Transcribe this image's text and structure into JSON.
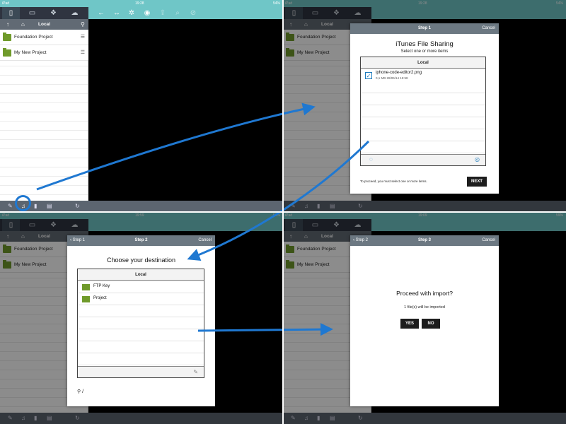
{
  "status_bar": {
    "device": "iPad",
    "time_q1": "19:28",
    "time_q2": "19:28",
    "time_q3": "19:59",
    "time_q4": "19:09",
    "battery_q1": "54%",
    "battery_q2": "54%",
    "battery_q3": "59%",
    "battery_q4": "59%"
  },
  "sidebar": {
    "title": "Local",
    "items": [
      {
        "label": "Foundation Project"
      },
      {
        "label": "My New Project"
      }
    ]
  },
  "icons": {
    "tab1": "phone-icon",
    "tab2": "monitor-icon",
    "tab3": "dropbox-icon",
    "tab4": "cloud-icon"
  },
  "accent_color": "#6fc6c7",
  "step1": {
    "step": "Step 1",
    "cancel": "Cancel",
    "title": "iTunes File Sharing",
    "subtitle": "Select one or more items",
    "list_header": "Local",
    "file_name": "iphone-code-editor2.png",
    "file_meta": "0,1 MB 28/06/14 15:58",
    "hint": "To proceed, you must select one or more items.",
    "next": "NEXT"
  },
  "step2": {
    "back": "Step 1",
    "step": "Step 2",
    "cancel": "Cancel",
    "title": "Choose your destination",
    "list_header": "Local",
    "items": [
      {
        "label": "FTP Key"
      },
      {
        "label": "Project"
      }
    ],
    "path": "/"
  },
  "step3": {
    "back": "Step 2",
    "step": "Step 3",
    "cancel": "Cancel",
    "question": "Proceed with import?",
    "detail": "1 file(s) will be imported",
    "yes": "YES",
    "no": "NO"
  }
}
